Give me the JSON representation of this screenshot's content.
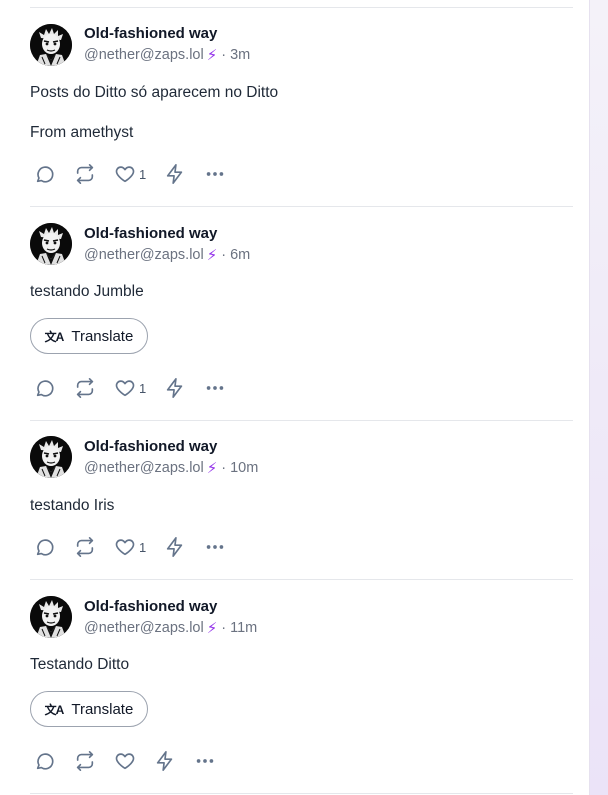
{
  "posts": [
    {
      "author": "Old-fashioned way",
      "handle": "@nether@zaps.lol",
      "time": "· 3m",
      "lines": [
        "Posts do Ditto só aparecem no Ditto",
        "From amethyst"
      ],
      "translate_label": null,
      "likes": "1"
    },
    {
      "author": "Old-fashioned way",
      "handle": "@nether@zaps.lol",
      "time": "· 6m",
      "lines": [
        "testando Jumble"
      ],
      "translate_label": "Translate",
      "likes": "1"
    },
    {
      "author": "Old-fashioned way",
      "handle": "@nether@zaps.lol",
      "time": "· 10m",
      "lines": [
        "testando Iris"
      ],
      "translate_label": null,
      "likes": "1"
    },
    {
      "author": "Old-fashioned way",
      "handle": "@nether@zaps.lol",
      "time": "· 11m",
      "lines": [
        "Testando Ditto"
      ],
      "translate_label": "Translate",
      "likes": ""
    }
  ],
  "icons": {
    "reply": "reply-icon",
    "repost": "repost-icon",
    "like": "heart-icon",
    "zap": "zap-icon",
    "more": "more-icon",
    "verified_zap": "lightning-icon",
    "translate": "translate-icon"
  },
  "colors": {
    "accent": "#9333ea",
    "icon": "#64748b",
    "divider": "#e5e7eb"
  }
}
